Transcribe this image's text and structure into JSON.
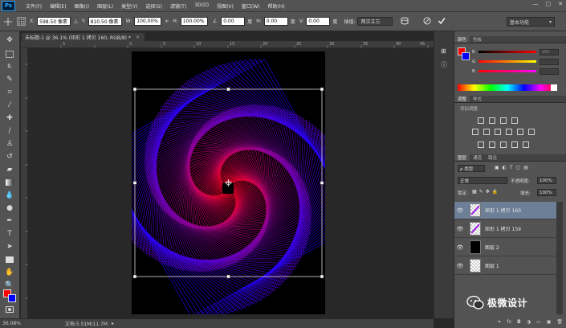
{
  "app": {
    "logo": "Ps"
  },
  "menu": [
    "文件(F)",
    "编辑(E)",
    "图像(I)",
    "图层(L)",
    "类型(Y)",
    "选择(S)",
    "滤镜(T)",
    "3D(D)",
    "视图(V)",
    "窗口(W)",
    "帮助(H)"
  ],
  "window_controls": [
    "—",
    "▢",
    "✕"
  ],
  "options": {
    "x_label": "X:",
    "x_value": "598.50 像素",
    "y_label": "Y:",
    "y_value": "810.50 像素",
    "w_label": "W:",
    "w_value": "100.00%",
    "h_label": "H:",
    "h_value": "100.00%",
    "angle_value": "0.00",
    "angle_unit": "度",
    "hskew_label": "H:",
    "hskew_value": "0.00",
    "hskew_unit": "度",
    "vskew_label": "V:",
    "vskew_value": "0.00",
    "vskew_unit": "度",
    "interp_label": "插值:",
    "interp_value": "两次立方",
    "cancel_icon": "cancel-icon",
    "commit_icon": "check-icon",
    "workspace": "基本功能"
  },
  "document": {
    "tab_title": "未标题-1 @ 36.1% (矩形 1 拷贝 160, RGB/8) *",
    "tab_close": "×"
  },
  "rulers": {
    "h_ticks": [
      "5",
      "0",
      "5",
      "10",
      "15",
      "20",
      "25",
      "30",
      "35",
      "40",
      "45",
      "50"
    ]
  },
  "status": {
    "zoom": "36.08%",
    "doc_info": "文档:5.51M/11.7M"
  },
  "color_panel": {
    "tabs": [
      "颜色",
      "色板"
    ],
    "r_label": "R",
    "g_label": "G",
    "b_label": "B",
    "r_value": "255",
    "g_value": "",
    "b_value": "",
    "foreground": "#ff0000",
    "background": "#0000ff"
  },
  "adjust_panel": {
    "tabs": [
      "调整",
      "样式"
    ],
    "add_label": "添加调整"
  },
  "layers_panel": {
    "tabs": [
      "图层",
      "通道",
      "路径"
    ],
    "filter_kind": "ρ 类型",
    "blend_mode": "正常",
    "opacity_label": "不透明度:",
    "opacity_value": "100%",
    "lock_label": "锁定:",
    "fill_label": "填充:",
    "fill_value": "100%",
    "layers": [
      {
        "name": "矩形 1 拷贝 160",
        "selected": true,
        "thumb": "shape"
      },
      {
        "name": "矩形 1 拷贝 159",
        "selected": false,
        "thumb": "shape"
      },
      {
        "name": "图层 2",
        "selected": false,
        "thumb": "black"
      },
      {
        "name": "图层 1",
        "selected": false,
        "thumb": "transparent"
      }
    ]
  },
  "watermark": {
    "text": "极微设计"
  }
}
